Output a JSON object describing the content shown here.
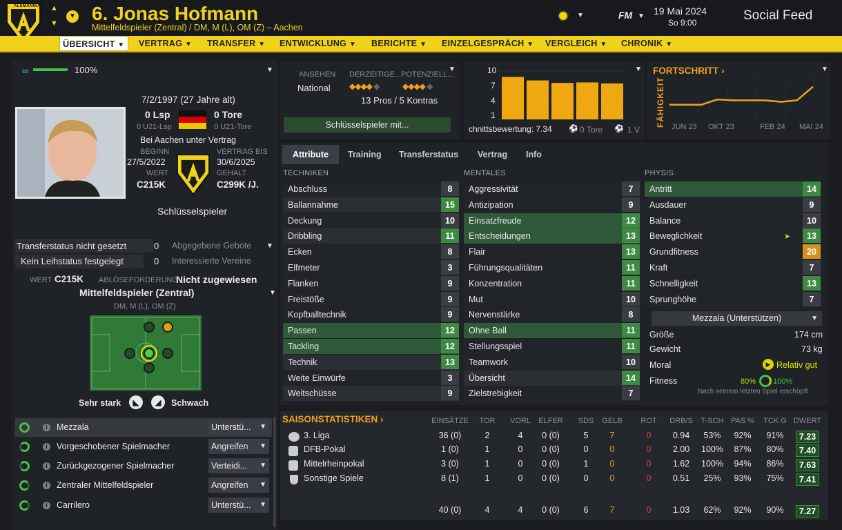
{
  "header": {
    "title": "6. Jonas Hofmann",
    "subtitle": "Mittelfeldspieler (Zentral) / DM, M (L), OM (Z) – Aachen",
    "club_crest": "ALEMANNIA",
    "fm_label": "FM",
    "date": "19 Mai 2024",
    "time": "So 9:00",
    "social_feed": "Social Feed"
  },
  "nav": {
    "items": [
      "ÜBERSICHT",
      "VERTRAG",
      "TRANSFER",
      "ENTWICKLUNG",
      "BERICHTE",
      "EINZELGESPRÄCH",
      "VERGLEICH",
      "CHRONIK"
    ]
  },
  "profile": {
    "condition_pct": "100%",
    "birth": "7/2/1997 (27 Jahre alt)",
    "lsp": "0 Lsp",
    "u21_lsp": "0 U21-Lsp",
    "tore": "0 Tore",
    "u21_tore": "0 U21-Tore",
    "contract_club": "Bei Aachen unter Vertrag",
    "beginn_label": "BEGINN",
    "beginn": "27/5/2022",
    "bis_label": "VERTRAG BIS",
    "bis": "30/6/2025",
    "wert_label": "WERT",
    "wert": "C215K",
    "gehalt_label": "GEHALT",
    "gehalt": "C299K /J.",
    "status": "Schlüsselspieler"
  },
  "transfer": {
    "transferstatus": "Transferstatus nicht gesetzt",
    "ts_count": "0",
    "gebote": "Abgegebene Gebote",
    "leihstatus": "Kein Leihstatus festgelegt",
    "ls_count": "0",
    "vereine": "Interessierte Vereine",
    "wert_label": "WERT",
    "wert": "C215K",
    "abl_label": "ABLÖSEFORDERUNG",
    "abl": "Nicht zugewiesen"
  },
  "position": {
    "title": "Mittelfeldspieler (Zentral)",
    "sub": "DM, M (L), OM (Z)",
    "strong": "Sehr stark",
    "weak": "Schwach"
  },
  "roles": [
    {
      "name": "Mezzala",
      "duty": "Unterstü..."
    },
    {
      "name": "Vorgeschobener Spielmacher",
      "duty": "Angreifen"
    },
    {
      "name": "Zurückgezogener Spielmacher",
      "duty": "Verteidi..."
    },
    {
      "name": "Zentraler Mittelfeldspieler",
      "duty": "Angreifen"
    },
    {
      "name": "Carrilero",
      "duty": "Unterstü..."
    }
  ],
  "reputation": {
    "ansehen_label": "ANSEHEN",
    "ansehen": "National",
    "derzeit_label": "DERZEITIGE...",
    "potenzial_label": "POTENZIELL...",
    "pros_cons": "13 Pros / 5 Kontras",
    "key_button": "Schlüsselspieler mit..."
  },
  "form_chart": {
    "y_ticks": [
      "10",
      "7",
      "4",
      "1"
    ],
    "values": [
      8.5,
      7.8,
      7.3,
      7.4,
      7.2
    ],
    "caption": "chnittsbewertung: 7.34",
    "tore": "0 Tore",
    "extra": "1 V"
  },
  "progress": {
    "title": "FORTSCHRITT",
    "ylabel": "FÄHIGKEIT",
    "x_ticks": [
      "JUN 23",
      "OKT 23",
      "FEB 24",
      "MAI 24"
    ],
    "values": [
      0.35,
      0.35,
      0.35,
      0.48,
      0.46,
      0.46,
      0.46,
      0.42,
      0.46,
      0.8
    ]
  },
  "tabs": [
    "Attribute",
    "Training",
    "Transferstatus",
    "Vertrag",
    "Info"
  ],
  "attributes": {
    "techniken_label": "TECHNIKEN",
    "mentales_label": "MENTALES",
    "physis_label": "PHYSIS",
    "techniken": [
      {
        "name": "Abschluss",
        "value": "8",
        "hl": "n"
      },
      {
        "name": "Ballannahme",
        "value": "15",
        "hl": "d"
      },
      {
        "name": "Deckung",
        "value": "10",
        "hl": "n"
      },
      {
        "name": "Dribbling",
        "value": "11",
        "hl": "d"
      },
      {
        "name": "Ecken",
        "value": "8",
        "hl": "n"
      },
      {
        "name": "Elfmeter",
        "value": "3",
        "hl": "n"
      },
      {
        "name": "Flanken",
        "value": "9",
        "hl": "n"
      },
      {
        "name": "Freistöße",
        "value": "9",
        "hl": "n"
      },
      {
        "name": "Kopfballtechnik",
        "value": "9",
        "hl": "n"
      },
      {
        "name": "Passen",
        "value": "12",
        "hl": "g"
      },
      {
        "name": "Tackling",
        "value": "12",
        "hl": "g"
      },
      {
        "name": "Technik",
        "value": "13",
        "hl": "d"
      },
      {
        "name": "Weite Einwürfe",
        "value": "3",
        "hl": "n"
      },
      {
        "name": "Weitschüsse",
        "value": "9",
        "hl": "d"
      }
    ],
    "mentales": [
      {
        "name": "Aggressivität",
        "value": "7",
        "hl": "n"
      },
      {
        "name": "Antizipation",
        "value": "9",
        "hl": "n"
      },
      {
        "name": "Einsatzfreude",
        "value": "12",
        "hl": "g"
      },
      {
        "name": "Entscheidungen",
        "value": "13",
        "hl": "g"
      },
      {
        "name": "Flair",
        "value": "13",
        "hl": "n"
      },
      {
        "name": "Führungsqualitäten",
        "value": "11",
        "hl": "n"
      },
      {
        "name": "Konzentration",
        "value": "11",
        "hl": "n"
      },
      {
        "name": "Mut",
        "value": "10",
        "hl": "n"
      },
      {
        "name": "Nervenstärke",
        "value": "8",
        "hl": "n"
      },
      {
        "name": "Ohne Ball",
        "value": "11",
        "hl": "g"
      },
      {
        "name": "Stellungsspiel",
        "value": "11",
        "hl": "n"
      },
      {
        "name": "Teamwork",
        "value": "10",
        "hl": "n"
      },
      {
        "name": "Übersicht",
        "value": "14",
        "hl": "d"
      },
      {
        "name": "Zielstrebigkeit",
        "value": "7",
        "hl": "n"
      }
    ],
    "physis": [
      {
        "name": "Antritt",
        "value": "14",
        "hl": "g"
      },
      {
        "name": "Ausdauer",
        "value": "9",
        "hl": "n"
      },
      {
        "name": "Balance",
        "value": "10",
        "hl": "n"
      },
      {
        "name": "Beweglichkeit",
        "value": "13",
        "hl": "n"
      },
      {
        "name": "Grundfitness",
        "value": "20",
        "hl": "n"
      },
      {
        "name": "Kraft",
        "value": "7",
        "hl": "n"
      },
      {
        "name": "Schnelligkeit",
        "value": "13",
        "hl": "n"
      },
      {
        "name": "Sprunghöhe",
        "value": "7",
        "hl": "n"
      }
    ]
  },
  "physical_info": {
    "role_select": "Mezzala (Unterstützen)",
    "groesse_label": "Größe",
    "groesse": "174 cm",
    "gewicht_label": "Gewicht",
    "gewicht": "73 kg",
    "moral_label": "Moral",
    "moral": "Relativ gut",
    "fitness_label": "Fitness",
    "fitness_a": "80%",
    "fitness_b": "100%",
    "fitness_note": "Nach seinem letzten Spiel erschöpft"
  },
  "season": {
    "title": "SAISONSTATISTIKEN",
    "columns": [
      "EINSÄTZE",
      "TOR",
      "VORL",
      "ELFER",
      "SDS",
      "GELB",
      "ROT",
      "DRB/S",
      "T-SCH",
      "PAS %",
      "TCK G",
      "DWERT"
    ],
    "rows": [
      {
        "comp": "3. Liga",
        "cells": [
          "36 (0)",
          "2",
          "4",
          "0 (0)",
          "5",
          "7",
          "0",
          "0.94",
          "53%",
          "92%",
          "91%",
          "7.23"
        ]
      },
      {
        "comp": "DFB-Pokal",
        "cells": [
          "1 (0)",
          "1",
          "0",
          "0 (0)",
          "0",
          "0",
          "0",
          "2.00",
          "100%",
          "87%",
          "80%",
          "7.40"
        ]
      },
      {
        "comp": "Mittelrheinpokal",
        "cells": [
          "3 (0)",
          "1",
          "0",
          "0 (0)",
          "1",
          "0",
          "0",
          "1.62",
          "100%",
          "94%",
          "86%",
          "7.63"
        ]
      },
      {
        "comp": "Sonstige Spiele",
        "cells": [
          "8 (1)",
          "1",
          "0",
          "0 (0)",
          "0",
          "0",
          "0",
          "0.51",
          "25%",
          "93%",
          "75%",
          "7.41"
        ]
      }
    ],
    "total": [
      "40 (0)",
      "4",
      "4",
      "0 (0)",
      "6",
      "7",
      "0",
      "1.03",
      "62%",
      "92%",
      "90%",
      "7.27"
    ]
  },
  "colors": {
    "accent": "#f0d21c",
    "green": "#3e8a45",
    "orange": "#d39220",
    "panel": "#24272c"
  }
}
